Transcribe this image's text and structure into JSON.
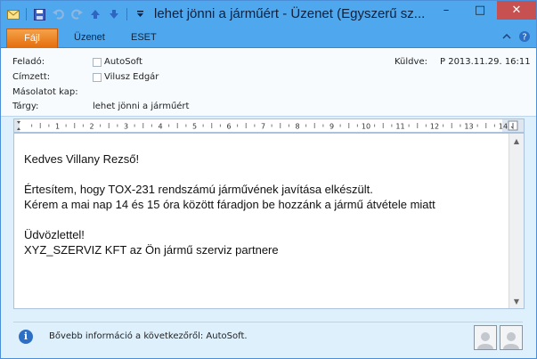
{
  "window": {
    "title": "lehet jönni a járműért  -  Üzenet (Egyszerű sz...",
    "controls": {
      "minimize": "–",
      "maximize": "□",
      "close": "✕"
    }
  },
  "quick_access": {
    "icons": [
      "mail-icon",
      "save-icon",
      "undo-icon",
      "redo-icon",
      "up-arrow-icon",
      "down-arrow-icon",
      "customize-icon"
    ]
  },
  "ribbon": {
    "tabs": [
      "Fájl",
      "Üzenet",
      "ESET"
    ],
    "active_tab": "Fájl",
    "file_tab_color": "#e46c0a"
  },
  "header": {
    "from_label": "Feladó:",
    "from_value": "AutoSoft",
    "to_label": "Címzett:",
    "to_value": "Vilusz Edgár",
    "cc_label": "Másolatot kap:",
    "cc_value": "",
    "subject_label": "Tárgy:",
    "subject_value": "lehet jönni a járműért",
    "sent_label": "Küldve:",
    "sent_value": "P 2013.11.29. 16:11"
  },
  "ruler": {
    "numbers": [
      "1",
      "2",
      "3",
      "4",
      "5",
      "6",
      "7",
      "8",
      "9",
      "10",
      "11",
      "12",
      "13",
      "14"
    ]
  },
  "body": {
    "lines": [
      "Kedves Villany Rezső!",
      "",
      "Értesítem, hogy TOX-231 rendszámú járművének javítása elkészült.",
      "Kérem a mai nap 14 és 15 óra között fáradjon be hozzánk a jármű átvétele miatt",
      "",
      "Üdvözlettel!",
      "XYZ_SZERVIZ KFT az Ön jármű szerviz partnere"
    ]
  },
  "people_pane": {
    "info_text": "Bővebb információ a következőről: AutoSoft."
  },
  "colors": {
    "title_bar": "#4fa8ee",
    "window_bg": "#dff0fd",
    "close_button": "#c75050"
  }
}
